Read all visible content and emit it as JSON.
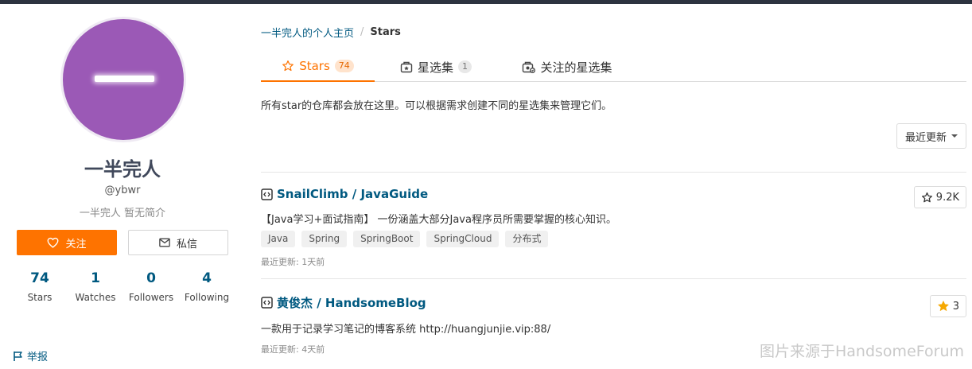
{
  "profile": {
    "name": "一半完人",
    "username": "@ybwr",
    "bio": "一半完人 暂无简介",
    "follow_label": "关注",
    "message_label": "私信",
    "stats": [
      {
        "num": "74",
        "label": "Stars"
      },
      {
        "num": "1",
        "label": "Watches"
      },
      {
        "num": "0",
        "label": "Followers"
      },
      {
        "num": "4",
        "label": "Following"
      }
    ],
    "report_label": "举报",
    "avatar_color": "#9b59b6"
  },
  "breadcrumb": {
    "home": "一半完人的个人主页",
    "separator": "/",
    "current": "Stars"
  },
  "tabs": [
    {
      "label": "Stars",
      "count": "74",
      "icon": "star-icon"
    },
    {
      "label": "星选集",
      "count": "1",
      "icon": "collection-icon"
    },
    {
      "label": "关注的星选集",
      "count": "",
      "icon": "followed-collection-icon"
    }
  ],
  "description": "所有star的仓库都会放在这里。可以根据需求创建不同的星选集来管理它们。",
  "sort": {
    "label": "最近更新"
  },
  "repos": [
    {
      "title": "SnailClimb / JavaGuide",
      "desc": "【Java学习+面试指南】 一份涵盖大部分Java程序员所需要掌握的核心知识。",
      "tags": [
        "Java",
        "Spring",
        "SpringBoot",
        "SpringCloud",
        "分布式"
      ],
      "updated": "最近更新: 1天前",
      "stars": "9.2K",
      "starred": false
    },
    {
      "title": "黄俊杰 / HandsomeBlog",
      "desc": "一款用于记录学习笔记的博客系统 http://huangjunjie.vip:88/",
      "tags": [],
      "updated": "最近更新: 4天前",
      "stars": "3",
      "starred": true
    }
  ],
  "watermark": "图片来源于HandsomeForum",
  "colors": {
    "accent": "#fe7300",
    "link": "#005980",
    "star_fill": "#f6a800"
  }
}
